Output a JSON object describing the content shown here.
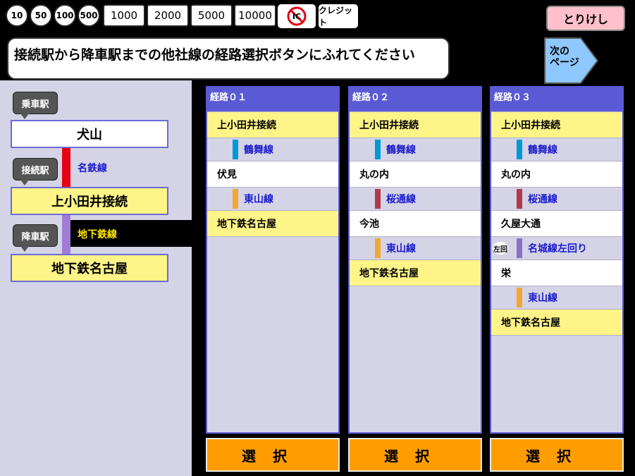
{
  "payment": {
    "coins": [
      "10",
      "50",
      "100",
      "500"
    ],
    "bills": [
      "1000",
      "2000",
      "5000",
      "10000"
    ],
    "ic_label": "IC",
    "credit_label": "クレジット"
  },
  "cancel_label": "とりけし",
  "instruction": "接続駅から降車駅までの他社線の経路選択ボタンにふれてください",
  "next_page": {
    "line1": "次の",
    "line2": "ページ"
  },
  "journey": {
    "boarding_tag": "乗車駅",
    "boarding_station": "犬山",
    "transfer_tag": "接続駅",
    "first_line": "名鉄線",
    "transfer_station": "上小田井接続",
    "alighting_tag": "降車駅",
    "second_line": "地下鉄線",
    "alighting_station": "地下鉄名古屋"
  },
  "colors": {
    "meitetsu": "#e60012",
    "subway": "#a07cd6",
    "tsurumai": "#0099d6",
    "sakuradori": "#b23a48",
    "higashiyama": "#f0a830",
    "meijo": "#8a6fc8"
  },
  "routes": [
    {
      "title": "経路０１",
      "select_label": "選択",
      "steps": [
        {
          "kind": "station",
          "name": "上小田井接続",
          "style": "yellow"
        },
        {
          "kind": "line",
          "name": "鶴舞線",
          "color": "tsurumai"
        },
        {
          "kind": "station",
          "name": "伏見",
          "style": "white"
        },
        {
          "kind": "line",
          "name": "東山線",
          "color": "higashiyama"
        },
        {
          "kind": "station",
          "name": "地下鉄名古屋",
          "style": "yellow"
        }
      ]
    },
    {
      "title": "経路０２",
      "select_label": "選択",
      "steps": [
        {
          "kind": "station",
          "name": "上小田井接続",
          "style": "yellow"
        },
        {
          "kind": "line",
          "name": "鶴舞線",
          "color": "tsurumai"
        },
        {
          "kind": "station",
          "name": "丸の内",
          "style": "white"
        },
        {
          "kind": "line",
          "name": "桜通線",
          "color": "sakuradori"
        },
        {
          "kind": "station",
          "name": "今池",
          "style": "white"
        },
        {
          "kind": "line",
          "name": "東山線",
          "color": "higashiyama"
        },
        {
          "kind": "station",
          "name": "地下鉄名古屋",
          "style": "yellow"
        }
      ]
    },
    {
      "title": "経路０３",
      "select_label": "選択",
      "steps": [
        {
          "kind": "station",
          "name": "上小田井接続",
          "style": "yellow"
        },
        {
          "kind": "line",
          "name": "鶴舞線",
          "color": "tsurumai"
        },
        {
          "kind": "station",
          "name": "丸の内",
          "style": "white"
        },
        {
          "kind": "line",
          "name": "桜通線",
          "color": "sakuradori"
        },
        {
          "kind": "station",
          "name": "久屋大通",
          "style": "white"
        },
        {
          "kind": "line",
          "name": "名城線左回り",
          "color": "meijo",
          "loop_badge": "左回"
        },
        {
          "kind": "station",
          "name": "栄",
          "style": "white"
        },
        {
          "kind": "line",
          "name": "東山線",
          "color": "higashiyama"
        },
        {
          "kind": "station",
          "name": "地下鉄名古屋",
          "style": "yellow"
        }
      ]
    }
  ]
}
